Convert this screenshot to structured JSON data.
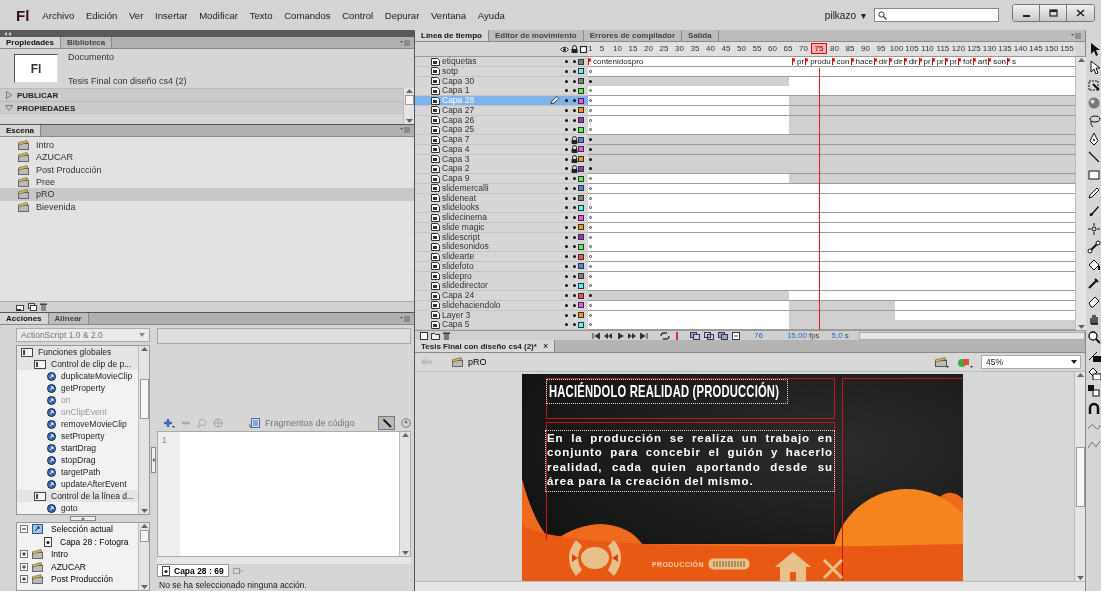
{
  "app": {
    "logo": "Fl",
    "menu": [
      "Archivo",
      "Edición",
      "Ver",
      "Insertar",
      "Modificar",
      "Texto",
      "Comandos",
      "Control",
      "Depurar",
      "Ventana",
      "Ayuda"
    ],
    "user": "pilkazo",
    "user_caret": "▾"
  },
  "properties_panel": {
    "tabs": [
      {
        "label": "Propiedades",
        "selected": true
      },
      {
        "label": "Biblioteca",
        "selected": false
      }
    ],
    "doc_icon": "Fl",
    "doc_type": "Documento",
    "doc_name": "Tesis Final con diseño cs4 (2)",
    "sections": [
      {
        "label": "PUBLICAR",
        "expanded": false
      },
      {
        "label": "PROPIEDADES",
        "expanded": true
      }
    ]
  },
  "scene_panel": {
    "tabs": [
      {
        "label": "Escena",
        "selected": true
      }
    ],
    "scenes": [
      {
        "name": "Intro",
        "selected": false
      },
      {
        "name": "AZUCAR",
        "selected": false
      },
      {
        "name": "Post Producción",
        "selected": false
      },
      {
        "name": "Pree",
        "selected": false
      },
      {
        "name": "pRO",
        "selected": true
      },
      {
        "name": "Bievenida",
        "selected": false
      }
    ]
  },
  "actions_panel": {
    "tabs": [
      {
        "label": "Acciones",
        "selected": true
      },
      {
        "label": "Alinear",
        "selected": false
      }
    ],
    "language": "ActionScript 1.0 & 2.0",
    "toolbox": [
      {
        "label": "Funciones globales",
        "kind": "book",
        "children": [
          {
            "label": "Control de clip de p...",
            "kind": "book",
            "children": [
              {
                "label": "duplicateMovieClip",
                "kind": "action",
                "disabled": false
              },
              {
                "label": "getProperty",
                "kind": "action",
                "disabled": false
              },
              {
                "label": "on",
                "kind": "action",
                "disabled": true
              },
              {
                "label": "onClipEvent",
                "kind": "action",
                "disabled": true
              },
              {
                "label": "removeMovieClip",
                "kind": "action",
                "disabled": false
              },
              {
                "label": "setProperty",
                "kind": "action",
                "disabled": false
              },
              {
                "label": "startDrag",
                "kind": "action",
                "disabled": false
              },
              {
                "label": "stopDrag",
                "kind": "action",
                "disabled": false
              },
              {
                "label": "targetPath",
                "kind": "action",
                "disabled": false
              },
              {
                "label": "updateAfterEvent",
                "kind": "action",
                "disabled": false
              }
            ]
          },
          {
            "label": "Control de la línea d...",
            "kind": "book",
            "children": [
              {
                "label": "goto",
                "kind": "action",
                "disabled": false
              }
            ]
          }
        ]
      }
    ],
    "navigator": [
      {
        "label": "Selección actual",
        "kind": "selection",
        "expanded": true,
        "children": [
          {
            "label": "Capa 28 : Fotogra",
            "kind": "frame"
          }
        ]
      },
      {
        "label": "Intro",
        "kind": "scene",
        "expanded": false
      },
      {
        "label": "AZUCAR",
        "kind": "scene",
        "expanded": false
      },
      {
        "label": "Post Producción",
        "kind": "scene",
        "expanded": false
      }
    ],
    "snippets": "Fragmentos de código",
    "line_numbers": [
      "1"
    ],
    "frame_tab": "Capa 28 : 69",
    "status": "No se ha seleccionado ninguna acción."
  },
  "timeline": {
    "tabs": [
      {
        "label": "Línea de tiempo",
        "selected": true
      },
      {
        "label": "Editor de movimiento",
        "selected": false
      },
      {
        "label": "Errores de compilador",
        "selected": false
      },
      {
        "label": "Salida",
        "selected": false
      }
    ],
    "ruler": [
      {
        "label": "1",
        "selected": false
      },
      {
        "label": "5",
        "selected": false
      },
      {
        "label": "10",
        "selected": false
      },
      {
        "label": "15",
        "selected": false
      },
      {
        "label": "20",
        "selected": false
      },
      {
        "label": "25",
        "selected": false
      },
      {
        "label": "30",
        "selected": false
      },
      {
        "label": "35",
        "selected": false
      },
      {
        "label": "40",
        "selected": false
      },
      {
        "label": "45",
        "selected": false
      },
      {
        "label": "50",
        "selected": false
      },
      {
        "label": "55",
        "selected": false
      },
      {
        "label": "60",
        "selected": false
      },
      {
        "label": "65",
        "selected": false
      },
      {
        "label": "70",
        "selected": false
      },
      {
        "label": "75",
        "selected": true
      },
      {
        "label": "80",
        "selected": false
      },
      {
        "label": "85",
        "selected": false
      },
      {
        "label": "90",
        "selected": false
      },
      {
        "label": "95",
        "selected": false
      },
      {
        "label": "100",
        "selected": false
      },
      {
        "label": "105",
        "selected": false
      },
      {
        "label": "110",
        "selected": false
      },
      {
        "label": "115",
        "selected": false
      },
      {
        "label": "120",
        "selected": false
      },
      {
        "label": "125",
        "selected": false
      },
      {
        "label": "130",
        "selected": false
      },
      {
        "label": "135",
        "selected": false
      },
      {
        "label": "140",
        "selected": false
      },
      {
        "label": "145",
        "selected": false
      },
      {
        "label": "150",
        "selected": false
      },
      {
        "label": "155",
        "selected": false
      }
    ],
    "layers": [
      {
        "name": "etiquetas",
        "color": "#808080",
        "locked": false,
        "selected": false,
        "kind": "labels",
        "labels": [
          "contenidospro",
          "pr",
          "produ",
          "con",
          "hace",
          "dir",
          "dir",
          "dir",
          "pr",
          "pr",
          "pr",
          "fot",
          "art",
          "son",
          "s"
        ]
      },
      {
        "name": "sotp",
        "color": "#4fffff",
        "locked": false,
        "selected": false,
        "kind": "empty"
      },
      {
        "name": "Capa 30",
        "color": "#808080",
        "locked": false,
        "selected": false,
        "kind": "before"
      },
      {
        "name": "Capa 1",
        "color": "#4fff4f",
        "locked": false,
        "selected": false,
        "kind": "empty"
      },
      {
        "name": "Capa 28",
        "color": "#ff4fff",
        "locked": false,
        "selected": true,
        "kind": "after"
      },
      {
        "name": "Capa 27",
        "color": "#ff9900",
        "locked": false,
        "selected": false,
        "kind": "after"
      },
      {
        "name": "Capa 26",
        "color": "#9933cc",
        "locked": false,
        "selected": false,
        "kind": "after"
      },
      {
        "name": "Capa 25",
        "color": "#4fff4f",
        "locked": false,
        "selected": false,
        "kind": "after"
      },
      {
        "name": "Capa 7",
        "color": "#4f81ff",
        "locked": true,
        "selected": false,
        "kind": "full"
      },
      {
        "name": "Capa 4",
        "color": "#ff4fff",
        "locked": true,
        "selected": false,
        "kind": "full"
      },
      {
        "name": "Capa 3",
        "color": "#ff9900",
        "locked": true,
        "selected": false,
        "kind": "full"
      },
      {
        "name": "Capa 2",
        "color": "#9933cc",
        "locked": true,
        "selected": false,
        "kind": "full"
      },
      {
        "name": "Capa 9",
        "color": "#4fff4f",
        "locked": false,
        "selected": false,
        "kind": "after"
      },
      {
        "name": "slidemercalli",
        "color": "#4f81ff",
        "locked": false,
        "selected": false,
        "kind": "empty"
      },
      {
        "name": "slideneat",
        "color": "#808080",
        "locked": false,
        "selected": false,
        "kind": "empty"
      },
      {
        "name": "slidelooks",
        "color": "#4fffff",
        "locked": false,
        "selected": false,
        "kind": "empty"
      },
      {
        "name": "slidecinema",
        "color": "#ff4fff",
        "locked": false,
        "selected": false,
        "kind": "empty"
      },
      {
        "name": "slide magic",
        "color": "#ff9900",
        "locked": false,
        "selected": false,
        "kind": "empty"
      },
      {
        "name": "slidescript",
        "color": "#9933cc",
        "locked": false,
        "selected": false,
        "kind": "empty"
      },
      {
        "name": "slidesonidos",
        "color": "#4fff4f",
        "locked": false,
        "selected": false,
        "kind": "empty"
      },
      {
        "name": "slidearte",
        "color": "#ff4f4f",
        "locked": false,
        "selected": false,
        "kind": "empty"
      },
      {
        "name": "slidefoto",
        "color": "#4f81ff",
        "locked": false,
        "selected": false,
        "kind": "empty"
      },
      {
        "name": "slidepro",
        "color": "#808080",
        "locked": false,
        "selected": false,
        "kind": "empty"
      },
      {
        "name": "slidedirector",
        "color": "#4fffff",
        "locked": false,
        "selected": false,
        "kind": "empty"
      },
      {
        "name": "Capa 24",
        "color": "#ff4f4f",
        "locked": false,
        "selected": false,
        "kind": "before"
      },
      {
        "name": "slidehaciendolo",
        "color": "#ff4fff",
        "locked": false,
        "selected": false,
        "kind": "mid"
      },
      {
        "name": "Layer 3",
        "color": "#ff9900",
        "locked": false,
        "selected": false,
        "kind": "mid"
      },
      {
        "name": "Capa 5",
        "color": "#4fffff",
        "locked": false,
        "selected": false,
        "kind": "after"
      }
    ],
    "current_frame": "76",
    "fps": "15,00",
    "fps_unit": "fps",
    "time": "5,0",
    "time_unit": "s"
  },
  "document": {
    "tab": "Tesis Final con diseño cs4 (2)*",
    "close": "×",
    "scene": "pRO",
    "zoom": "45%",
    "stage": {
      "title": "HACIÉNDOLO REALIDAD (PRODUCCIÓN)",
      "body": "En la producción se realiza un trabajo en conjunto para concebir el guión y hacerlo realidad, cada quien aportando desde su área para la creación del mismo.",
      "nav_label": "PRODUCCIÓN"
    }
  }
}
